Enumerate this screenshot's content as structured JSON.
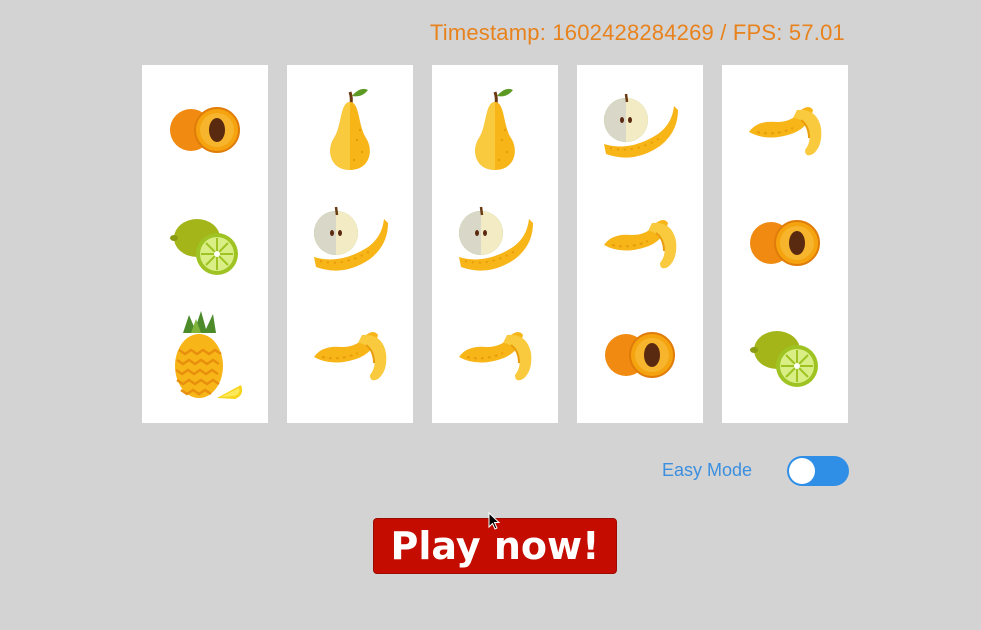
{
  "status_text": "Timestamp: 1602428284269 / FPS: 57.01",
  "reels": [
    [
      "apricot",
      "lime",
      "pineapple"
    ],
    [
      "pear",
      "apple-banana",
      "banana"
    ],
    [
      "pear",
      "apple-banana",
      "banana"
    ],
    [
      "apple-banana",
      "banana",
      "apricot"
    ],
    [
      "banana",
      "apricot",
      "lime"
    ]
  ],
  "easy_mode": {
    "label": "Easy Mode",
    "enabled": false
  },
  "play_button": {
    "label": "Play now!"
  },
  "colors": {
    "background": "#d3d3d3",
    "status": "#e8821c",
    "toggle": "#2f8fe6",
    "play": "#c40d00"
  }
}
